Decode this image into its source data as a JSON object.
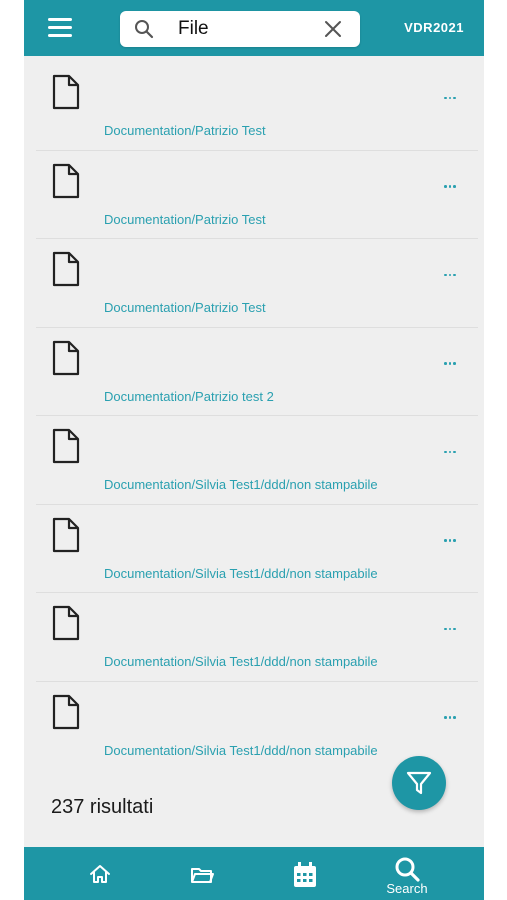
{
  "header": {
    "search_value": "File",
    "project": "VDR2021"
  },
  "items": [
    {
      "path": "Documentation/Patrizio Test"
    },
    {
      "path": "Documentation/Patrizio Test"
    },
    {
      "path": "Documentation/Patrizio Test"
    },
    {
      "path": "Documentation/Patrizio test 2"
    },
    {
      "path": "Documentation/Silvia Test1/ddd/non stampabile"
    },
    {
      "path": "Documentation/Silvia Test1/ddd/non stampabile"
    },
    {
      "path": "Documentation/Silvia Test1/ddd/non stampabile"
    },
    {
      "path": "Documentation/Silvia Test1/ddd/non stampabile"
    }
  ],
  "results_count": "237 risultati",
  "nav": {
    "search_label": "Search",
    "icons": [
      "home-icon",
      "folder-icon",
      "calendar-icon",
      "search-icon"
    ]
  },
  "colors": {
    "accent": "#1e96a5",
    "link": "#2aa0b0",
    "background": "#efefef"
  }
}
